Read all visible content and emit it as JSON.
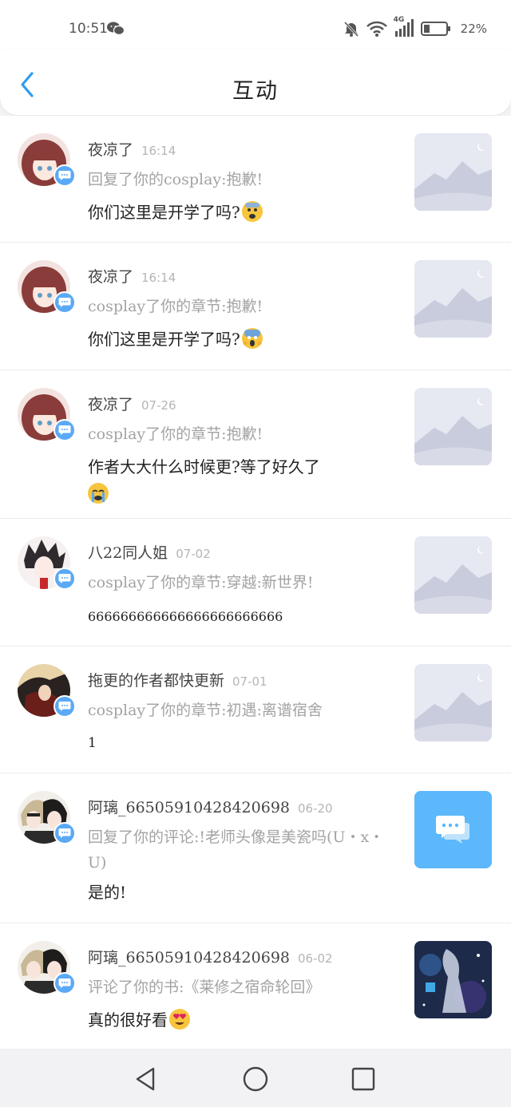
{
  "status_bar": {
    "time": "10:51",
    "network": "4G",
    "battery": "22%"
  },
  "header": {
    "title": "互动",
    "back_icon": "chevron-left-icon"
  },
  "items": [
    {
      "username": "夜凉了",
      "time": "16:14",
      "context": "回复了你的cosplay:抱歉!",
      "message": "你们这里是开学了吗?",
      "emoji": "fearful-face",
      "thumbnail": "placeholder-landscape"
    },
    {
      "username": "夜凉了",
      "time": "16:14",
      "context": "cosplay了你的章节:抱歉!",
      "message": "你们这里是开学了吗?",
      "emoji": "screaming-face",
      "thumbnail": "placeholder-landscape"
    },
    {
      "username": "夜凉了",
      "time": "07-26",
      "context": "cosplay了你的章节:抱歉!",
      "message": "作者大大什么时候更?等了好久了",
      "emoji": "crying-face",
      "thumbnail": "placeholder-landscape"
    },
    {
      "username": "八22同人姐",
      "time": "07-02",
      "context": "cosplay了你的章节:穿越:新世界!",
      "message": "666666666666666666666666",
      "thumbnail": "placeholder-landscape"
    },
    {
      "username": "拖更的作者都快更新",
      "time": "07-01",
      "context": "cosplay了你的章节:初遇:离谱宿舍",
      "message": "1",
      "thumbnail": "placeholder-landscape"
    },
    {
      "username": "阿璃_66505910428420698",
      "time": "06-20",
      "context": "回复了你的评论:!老师头像是美瓷吗(U・x・U)",
      "message": "是的!",
      "thumbnail": "comment-icon"
    },
    {
      "username": "阿璃_66505910428420698",
      "time": "06-02",
      "context": "评论了你的书:《莱修之宿命轮回》",
      "message": "真的很好看",
      "emoji": "heart-eyes-face",
      "thumbnail": "book-cover"
    }
  ],
  "colors": {
    "accent": "#4aa3f5",
    "badge": "#5aa9f6",
    "thumb_placeholder": "#e6e8f2",
    "comment_tile": "#5cb8fb"
  }
}
